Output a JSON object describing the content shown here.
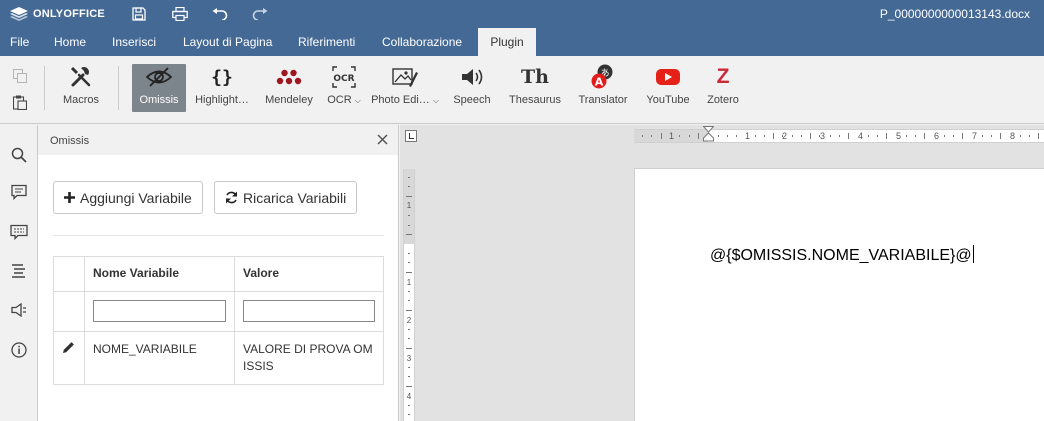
{
  "app": {
    "logo_text": "ONLYOFFICE",
    "document_title": "P_0000000000013143.docx"
  },
  "quick_access": [
    "save-icon",
    "print-icon",
    "undo-icon",
    "redo-icon"
  ],
  "menu_tabs": [
    {
      "label": "File"
    },
    {
      "label": "Home"
    },
    {
      "label": "Inserisci"
    },
    {
      "label": "Layout di Pagina"
    },
    {
      "label": "Riferimenti"
    },
    {
      "label": "Collaborazione"
    },
    {
      "label": "Plugin",
      "active": true
    }
  ],
  "ribbon": {
    "buttons": [
      {
        "label": "Macros",
        "icon": "tools-icon"
      },
      {
        "label": "Omissis",
        "icon": "eye-slash-icon",
        "selected": true
      },
      {
        "label": "Highlight…",
        "icon": "braces-icon"
      },
      {
        "label": "Mendeley",
        "icon": "mendeley-icon"
      },
      {
        "label": "OCR",
        "icon": "ocr-icon"
      },
      {
        "label": "Photo Edi…",
        "icon": "photo-editor-icon"
      },
      {
        "label": "Speech",
        "icon": "speaker-icon"
      },
      {
        "label": "Thesaurus",
        "icon": "thesaurus-icon",
        "glyph": "Th"
      },
      {
        "label": "Translator",
        "icon": "translator-icon"
      },
      {
        "label": "YouTube",
        "icon": "youtube-icon"
      },
      {
        "label": "Zotero",
        "icon": "zotero-icon",
        "glyph": "Z"
      }
    ]
  },
  "left_sidebar": [
    "search-icon",
    "comments-icon",
    "chat-icon",
    "navigation-icon",
    "feedback-icon",
    "about-icon"
  ],
  "plugin_panel": {
    "title": "Omissis",
    "add_button": "Aggiungi Variabile",
    "reload_button": "Ricarica Variabili",
    "table": {
      "headers": [
        "Nome Variabile",
        "Valore"
      ],
      "filter_name": "",
      "filter_value": "",
      "rows": [
        {
          "name": "NOME_VARIABILE",
          "value": "VALORE DI PROVA OMISSIS"
        }
      ]
    }
  },
  "ruler": {
    "h_numbers": [
      "1",
      "1",
      "2",
      "3",
      "4",
      "5",
      "6",
      "7",
      "8"
    ],
    "v_numbers": [
      "1",
      "1",
      "2",
      "3",
      "4"
    ]
  },
  "document": {
    "text": "@{$OMISSIS.NOME_VARIABILE}@"
  },
  "colors": {
    "header": "#446995",
    "selected_button": "#7d858c",
    "youtube": "#e62117",
    "zotero": "#cc2936",
    "mendeley": "#9d1620"
  }
}
